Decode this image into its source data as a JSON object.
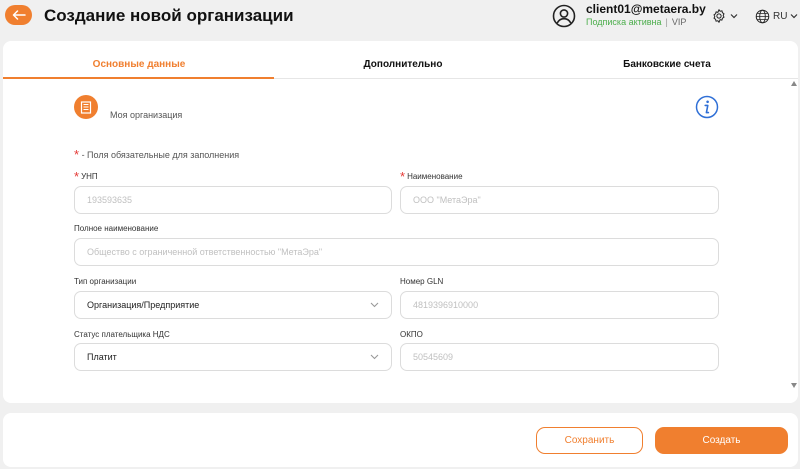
{
  "header": {
    "title": "Создание новой организации",
    "user_email": "client01@metaera.by",
    "subscription_status": "Подписка активна",
    "subscription_separator": "|",
    "plan": "VIP",
    "language": "RU"
  },
  "tabs": [
    {
      "label": "Основные данные",
      "active": true
    },
    {
      "label": "Дополнительно",
      "active": false
    },
    {
      "label": "Банковские счета",
      "active": false
    }
  ],
  "organization": {
    "name": "Моя организация"
  },
  "required_note": {
    "star": "*",
    "text": " - Поля обязательные для заполнения"
  },
  "fields": {
    "unp": {
      "label": "УНП",
      "placeholder": "193593635",
      "required": true
    },
    "name": {
      "label": "Наименование",
      "placeholder": "ООО \"МетаЭра\"",
      "required": true
    },
    "full_name": {
      "label": "Полное наименование",
      "placeholder": "Общество с ограниченной ответственностью \"МетаЭра\""
    },
    "org_type": {
      "label": "Тип организации",
      "value": "Организация/Предприятие"
    },
    "gln": {
      "label": "Номер GLN",
      "placeholder": "4819396910000"
    },
    "vat_status": {
      "label": "Статус плательщика НДС",
      "value": "Платит"
    },
    "okpo": {
      "label": "ОКПО",
      "placeholder": "50545609"
    }
  },
  "footer": {
    "save_label": "Сохранить",
    "create_label": "Создать"
  },
  "colors": {
    "accent": "#f07f2f",
    "required": "#e53935",
    "active_subscription": "#4cae4c",
    "info": "#2f6fd6"
  },
  "icons": [
    "arrow-left-icon",
    "user-circle-icon",
    "gear-icon",
    "globe-icon",
    "chevron-down-icon",
    "building-icon",
    "info-icon"
  ]
}
